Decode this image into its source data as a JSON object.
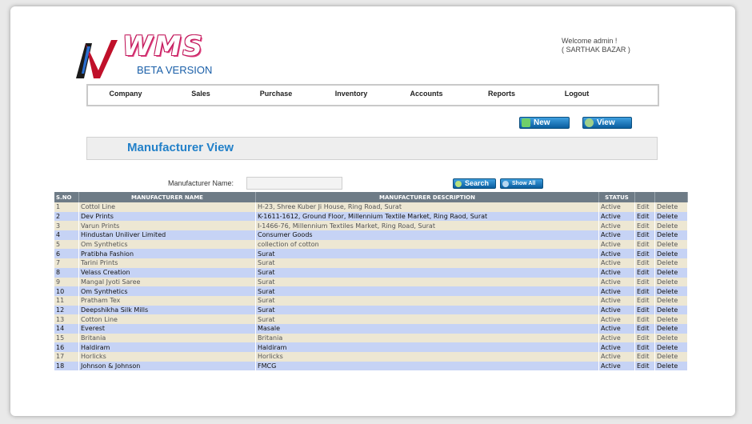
{
  "logo": {
    "text": "WMS",
    "subtitle": "BETA VERSION"
  },
  "welcome": {
    "line1": "Welcome admin !",
    "line2": "( SARTHAK BAZAR )"
  },
  "nav": [
    "Company",
    "Sales",
    "Purchase",
    "Inventory",
    "Accounts",
    "Reports",
    "Logout"
  ],
  "actions": {
    "new_label": "New",
    "view_label": "View"
  },
  "page": {
    "title": "Manufacturer View"
  },
  "search": {
    "label": "Manufacturer Name:",
    "value": "",
    "search_label": "Search",
    "showall_label": "Show All"
  },
  "table": {
    "headers": [
      "S.NO",
      "MANUFACTURER NAME",
      "MANUFACTURER DESCRIPTION",
      "STATUS",
      "",
      ""
    ],
    "rows": [
      {
        "sno": "1",
        "name": "Cottol Line",
        "desc": "H-23, Shree Kuber Ji House, Ring Road, Surat",
        "status": "Active",
        "edit": "Edit",
        "del": "Delete"
      },
      {
        "sno": "2",
        "name": "Dev Prints",
        "desc": "K-1611-1612, Ground Floor, Millennium Textile Market, Ring Raod, Surat",
        "status": "Active",
        "edit": "Edit",
        "del": "Delete"
      },
      {
        "sno": "3",
        "name": "Varun Prints",
        "desc": "I-1466-76, Millennium Textiles Market, Ring Road, Surat",
        "status": "Active",
        "edit": "Edit",
        "del": "Delete"
      },
      {
        "sno": "4",
        "name": "Hindustan Uniliver Limited",
        "desc": "Consumer Goods",
        "status": "Active",
        "edit": "Edit",
        "del": "Delete"
      },
      {
        "sno": "5",
        "name": "Om Synthetics",
        "desc": "collection of cotton",
        "status": "Active",
        "edit": "Edit",
        "del": "Delete"
      },
      {
        "sno": "6",
        "name": "Pratibha Fashion",
        "desc": "Surat",
        "status": "Active",
        "edit": "Edit",
        "del": "Delete"
      },
      {
        "sno": "7",
        "name": "Tarini Prints",
        "desc": "Surat",
        "status": "Active",
        "edit": "Edit",
        "del": "Delete"
      },
      {
        "sno": "8",
        "name": "Velass Creation",
        "desc": "Surat",
        "status": "Active",
        "edit": "Edit",
        "del": "Delete"
      },
      {
        "sno": "9",
        "name": "Mangal Jyoti Saree",
        "desc": "Surat",
        "status": "Active",
        "edit": "Edit",
        "del": "Delete"
      },
      {
        "sno": "10",
        "name": "Om Synthetics",
        "desc": "Surat",
        "status": "Active",
        "edit": "Edit",
        "del": "Delete"
      },
      {
        "sno": "11",
        "name": "Pratham Tex",
        "desc": "Surat",
        "status": "Active",
        "edit": "Edit",
        "del": "Delete"
      },
      {
        "sno": "12",
        "name": "Deepshikha Silk Mills",
        "desc": "Surat",
        "status": "Active",
        "edit": "Edit",
        "del": "Delete"
      },
      {
        "sno": "13",
        "name": "Cotton Line",
        "desc": "Surat",
        "status": "Active",
        "edit": "Edit",
        "del": "Delete"
      },
      {
        "sno": "14",
        "name": "Everest",
        "desc": "Masale",
        "status": "Active",
        "edit": "Edit",
        "del": "Delete"
      },
      {
        "sno": "15",
        "name": "Britania",
        "desc": "Britania",
        "status": "Active",
        "edit": "Edit",
        "del": "Delete"
      },
      {
        "sno": "16",
        "name": "Haldiram",
        "desc": "Haldiram",
        "status": "Active",
        "edit": "Edit",
        "del": "Delete"
      },
      {
        "sno": "17",
        "name": "Horlicks",
        "desc": "Horlicks",
        "status": "Active",
        "edit": "Edit",
        "del": "Delete"
      },
      {
        "sno": "18",
        "name": "Johnson & Johnson",
        "desc": "FMCG",
        "status": "Active",
        "edit": "Edit",
        "del": "Delete"
      }
    ]
  }
}
